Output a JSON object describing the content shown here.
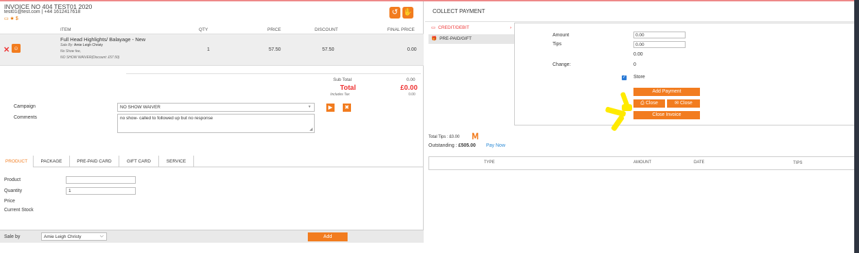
{
  "invoice": {
    "title": "INVOICE NO 404  TEST01 2020",
    "contact": "test01@test.com | +44 1612417618",
    "badges": "▭ ★ $",
    "icons": [
      "history-icon",
      "hand-icon"
    ]
  },
  "items_table": {
    "headers": {
      "item": "ITEM",
      "qty": "QTY",
      "price": "PRICE",
      "discount": "DISCOUNT",
      "final_price": "FINAL PRICE"
    },
    "rows": [
      {
        "name": "Full Head Highlights/ Balayage - New",
        "sale_by_label": "Sale By:",
        "sale_by": "Amie Leigh Christy",
        "note1": "No Show fee,",
        "note2": "NO SHOW WAIVER(Discount: £57.50)",
        "qty": "1",
        "price": "57.50",
        "discount": "57.50",
        "final_price": "0.00"
      }
    ]
  },
  "totals": {
    "subtotal_label": "Sub Total",
    "subtotal": "0.00",
    "total_label": "Total",
    "total": "£0.00",
    "includes_tax_label": "Includes Tax",
    "includes_tax": "0.00"
  },
  "campaign": {
    "label": "Campaign",
    "value": "NO SHOW WAIVER"
  },
  "comments": {
    "label": "Comments",
    "value": "no show- called to followed up but no response"
  },
  "tabs": [
    "PRODUCT",
    "PACKAGE",
    "PRE-PAID CARD",
    "GIFT CARD",
    "SERVICE"
  ],
  "active_tab": "PRODUCT",
  "product_form": {
    "product_label": "Product",
    "product_value": "",
    "quantity_label": "Quantity",
    "quantity_value": "1",
    "price_label": "Price",
    "stock_label": "Current Stock"
  },
  "footer": {
    "sale_by_label": "Sale by",
    "sale_by_value": "Amie Leigh Christy",
    "add_label": "Add"
  },
  "payment": {
    "title": "COLLECT PAYMENT",
    "methods": [
      "CREDIT/DEBIT",
      "PRE-PAID/GIFT"
    ],
    "active_method": "CREDIT/DEBIT",
    "amount_label": "Amount",
    "amount_value": "0.00",
    "tips_label": "Tips",
    "tips_value": "0.00",
    "tips_total": "0.00",
    "change_label": "Change:",
    "change_value": "0",
    "store_label": "Store",
    "store_checked": true,
    "add_payment_label": "Add Payment",
    "close_print_label": "Close",
    "close_email_label": "Close",
    "close_invoice_label": "Close Invoice"
  },
  "summary": {
    "total_tips": "Total Tips : £0.00",
    "outstanding_label": "Outstanding : ",
    "outstanding_value": "£505.00",
    "pay_now": "Pay Now"
  },
  "payments_table": {
    "headers": [
      "TYPE",
      "AMOUNT",
      "DATE",
      "TIPS"
    ]
  },
  "colors": {
    "accent": "#f27c1f",
    "total_red": "#e33333",
    "highlight": "#ffea00",
    "link": "#2a8ad6"
  }
}
